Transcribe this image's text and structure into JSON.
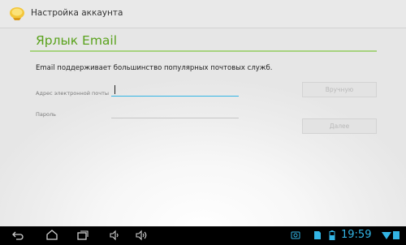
{
  "action_bar": {
    "title": "Настройка аккаунта",
    "icon": "email-app-icon"
  },
  "form": {
    "header": "Ярлык Email",
    "description": "Email поддерживает большинство популярных почтовых служб.",
    "email": {
      "label": "Адрес электронной почты",
      "value": ""
    },
    "password": {
      "label": "Пароль",
      "value": ""
    },
    "manual_button": "Вручную",
    "next_button": "Далее"
  },
  "system_bar": {
    "nav_icons": [
      "back-icon",
      "home-icon",
      "recent-apps-icon",
      "volume-down-icon",
      "volume-up-icon"
    ],
    "status_icons": [
      "screenshot-icon",
      "sd-card-icon",
      "battery-icon",
      "wifi-icon",
      "signal-icon"
    ],
    "time": "19:59"
  },
  "colors": {
    "accent_green": "#5aa21d",
    "accent_blue": "#33b5e5",
    "navbar": "#000000"
  }
}
